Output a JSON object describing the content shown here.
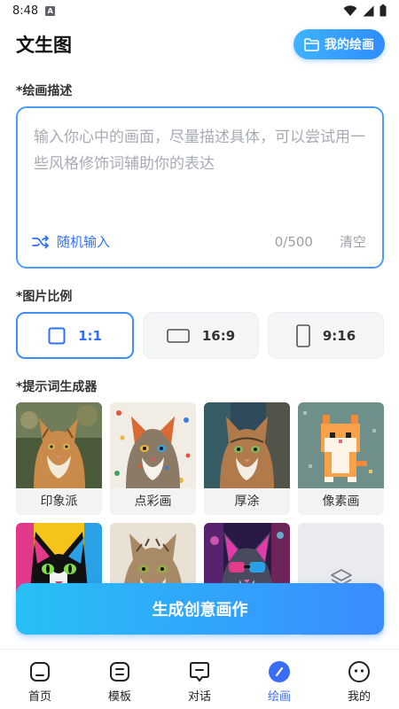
{
  "status_bar": {
    "time": "8:48",
    "notification_badge": "A"
  },
  "header": {
    "title": "文生图",
    "my_paintings_label": "我的绘画"
  },
  "description": {
    "section_label": "*绘画描述",
    "placeholder": "输入你心中的画面，尽量描述具体，可以尝试用一些风格修饰词辅助你的表达",
    "random_label": "随机输入",
    "char_count": "0/500",
    "clear_label": "清空"
  },
  "ratio": {
    "section_label": "*图片比例",
    "options": [
      {
        "label": "1:1",
        "icon": "square-icon",
        "selected": true
      },
      {
        "label": "16:9",
        "icon": "landscape-rect-icon",
        "selected": false
      },
      {
        "label": "9:16",
        "icon": "portrait-rect-icon",
        "selected": false
      }
    ]
  },
  "styles": {
    "section_label": "*提示词生成器",
    "items": [
      {
        "label": "印象派"
      },
      {
        "label": "点彩画"
      },
      {
        "label": "厚涂"
      },
      {
        "label": "像素画"
      },
      {
        "label": ""
      },
      {
        "label": ""
      },
      {
        "label": ""
      }
    ],
    "more_icon": "layers-icon"
  },
  "generate_label": "生成创意画作",
  "nav": {
    "items": [
      {
        "label": "首页",
        "icon": "home-icon"
      },
      {
        "label": "模板",
        "icon": "template-icon"
      },
      {
        "label": "对话",
        "icon": "chat-icon"
      },
      {
        "label": "绘画",
        "icon": "paint-icon",
        "active": true
      },
      {
        "label": "我的",
        "icon": "profile-icon"
      }
    ]
  },
  "colors": {
    "accent": "#2F6FFF",
    "button_gradient_start": "#27C0F5",
    "button_gradient_end": "#3A8CFF",
    "selected_border": "#3D8EFF"
  }
}
